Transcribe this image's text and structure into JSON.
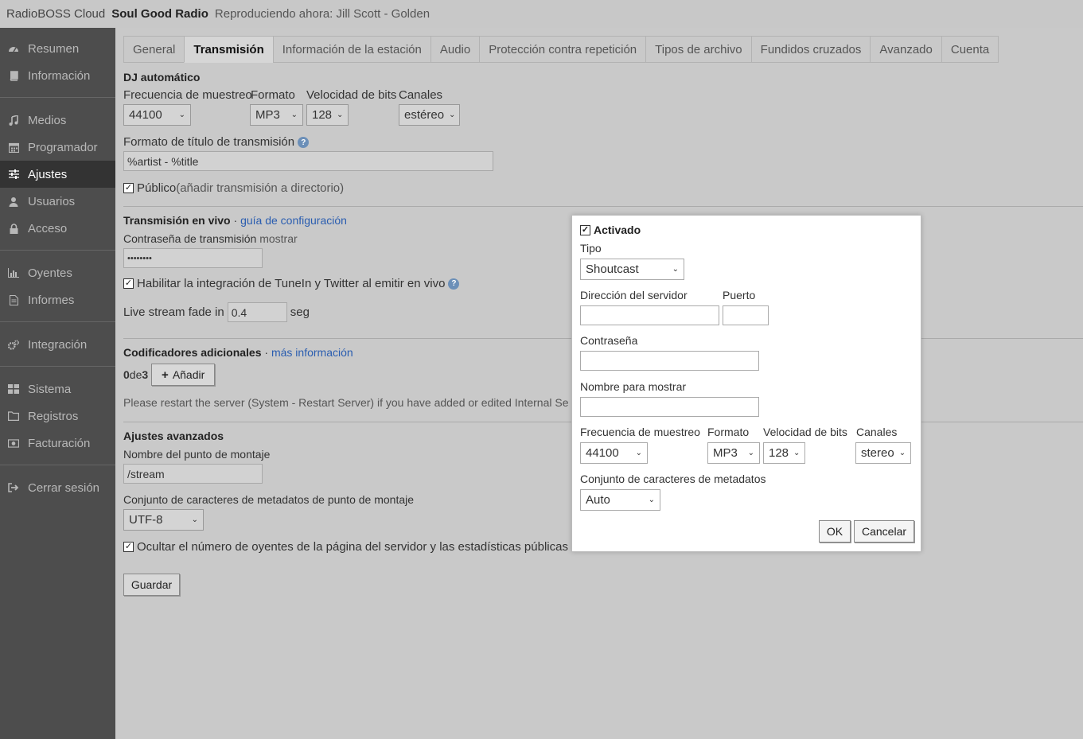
{
  "topbar": {
    "brand": "RadioBOSS Cloud",
    "station": "Soul Good Radio",
    "now_playing": "Reproduciendo ahora: Jill Scott - Golden"
  },
  "sidebar": {
    "items": [
      {
        "label": "Resumen",
        "icon": "dashboard-icon"
      },
      {
        "label": "Información",
        "icon": "book-icon"
      },
      {
        "label": "Medios",
        "icon": "music-note-icon"
      },
      {
        "label": "Programador",
        "icon": "calendar-icon"
      },
      {
        "label": "Ajustes",
        "icon": "sliders-icon"
      },
      {
        "label": "Usuarios",
        "icon": "user-icon"
      },
      {
        "label": "Acceso",
        "icon": "lock-icon"
      },
      {
        "label": "Oyentes",
        "icon": "bar-chart-icon"
      },
      {
        "label": "Informes",
        "icon": "document-icon"
      },
      {
        "label": "Integración",
        "icon": "cogs-icon"
      },
      {
        "label": "Sistema",
        "icon": "grid-icon"
      },
      {
        "label": "Registros",
        "icon": "folder-icon"
      },
      {
        "label": "Facturación",
        "icon": "money-icon"
      },
      {
        "label": "Cerrar sesión",
        "icon": "sign-out-icon"
      }
    ]
  },
  "tabs": [
    "General",
    "Transmisión",
    "Información de la estación",
    "Audio",
    "Protección contra repetición",
    "Tipos de archivo",
    "Fundidos cruzados",
    "Avanzado",
    "Cuenta"
  ],
  "autodj": {
    "heading": "DJ automático",
    "sample_rate_label": "Frecuencia de muestreo",
    "format_label": "Formato",
    "bitrate_label": "Velocidad de bits",
    "channels_label": "Canales",
    "sample_rate": "44100",
    "format": "MP3",
    "bitrate": "128",
    "channels": "estéreo",
    "title_format_label": "Formato de título de transmisión",
    "title_format": "%artist - %title",
    "public_label": "Público",
    "public_note": " (añadir transmisión a directorio)"
  },
  "live": {
    "heading": "Transmisión en vivo",
    "sep": " · ",
    "guide_link": "guía de configuración",
    "password_label": "Contraseña de transmisión",
    "show_link": " mostrar",
    "password": "••••••••",
    "tunein_label": "Habilitar la integración de TuneIn y Twitter al emitir en vivo",
    "fade_label": "Live stream fade in",
    "fade_value": "0.4",
    "fade_unit": "seg"
  },
  "encoders": {
    "heading": "Codificadores adicionales",
    "sep": " · ",
    "more_link": "más información",
    "count": "0",
    "of": " de ",
    "max": "3",
    "add_button": "Añadir",
    "restart_note": "Please restart the server (System - Restart Server) if you have added or edited Internal Se"
  },
  "advanced": {
    "heading": "Ajustes avanzados",
    "mount_label": "Nombre del punto de montaje",
    "mount_value": "/stream",
    "charset_label": "Conjunto de caracteres de metadatos de punto de montaje",
    "charset_value": "UTF-8",
    "hide_listeners_label": "Ocultar el número de oyentes de la página del servidor y las estadísticas públicas",
    "save_button": "Guardar"
  },
  "dialog": {
    "enabled_label": "Activado",
    "type_label": "Tipo",
    "type_value": "Shoutcast",
    "server_label": "Dirección del servidor",
    "port_label": "Puerto",
    "password_label": "Contraseña",
    "display_name_label": "Nombre para mostrar",
    "sample_rate_label": "Frecuencia de muestreo",
    "format_label": "Formato",
    "bitrate_label": "Velocidad de bits",
    "channels_label": "Canales",
    "sample_rate": "44100",
    "format": "MP3",
    "bitrate": "128",
    "channels": "stereo",
    "charset_label": "Conjunto de caracteres de metadatos",
    "charset_value": "Auto",
    "ok_button": "OK",
    "cancel_button": "Cancelar"
  },
  "colors": {
    "sidebar_bg": "#4d4d4d",
    "sidebar_active": "#333333",
    "link": "#2a5db0",
    "main_bg": "#c9c9c9"
  }
}
